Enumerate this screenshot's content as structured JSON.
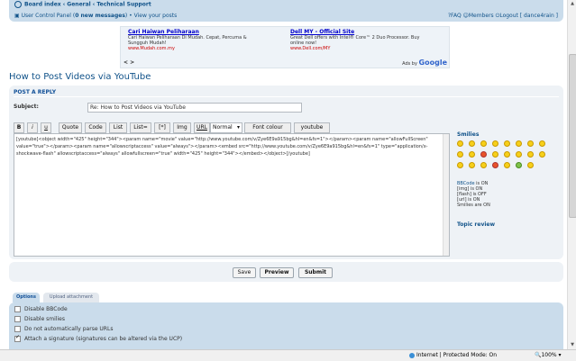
{
  "nav": {
    "breadcrumb": "Board index ‹ General ‹ Technical Support",
    "ucp": "User Control Panel (",
    "new_messages": "0 new messages",
    "ucp_close": ")",
    "sep": "•",
    "view_posts": "View your posts",
    "faq": "FAQ",
    "members": "Members",
    "logout": "Logout [ dance4rain ]"
  },
  "ads": {
    "ad1": {
      "title": "Cari Haiwan Peliharaan",
      "desc": "Cari Haiwan Peliharaan Di Mudah. Cepat, Percuma & Sungguh Mudah!",
      "url": "www.Mudah.com.my"
    },
    "ad2": {
      "title": "Dell MY - Official Site",
      "desc": "Great Dell offers with Intel® Core™ 2 Duo Processor. Buy online now!",
      "url": "www.Dell.com/MY"
    },
    "arrows": "< >",
    "adsby": "Ads by",
    "google": "Google"
  },
  "page_title": "How to Post Videos via YouTube",
  "post": {
    "section_title": "POST A REPLY",
    "subject_label": "Subject:",
    "subject_value": "Re: How to Post Videos via YouTube",
    "toolbar": [
      "B",
      "i",
      "u",
      "Quote",
      "Code",
      "List",
      "List=",
      "[*]",
      "Img",
      "URL"
    ],
    "font_size": "Normal",
    "font_colour": "Font colour",
    "youtube": "youtube",
    "message": "[youtube]<object width=\"425\" height=\"344\"><param name=\"movie\" value=\"http://www.youtube.com/v/Zye6E9a915bg&hl=en&fs=1\"></param><param name=\"allowFullScreen\" value=\"true\"></param><param name=\"allowscriptaccess\" value=\"always\"></param><embed src=\"http://www.youtube.com/v/Zye6E9a915bg&hl=en&fs=1\" type=\"application/x-shockwave-flash\" allowscriptaccess=\"always\" allowfullscreen=\"true\" width=\"425\" height=\"344\"></embed></object>[/youtube]"
  },
  "sidebar": {
    "smilies_heading": "Smilies",
    "bbcode_link": "BBCode",
    "bbcode_status": " is ON",
    "img_status": "[img] is ON",
    "flash_status": "[flash] is OFF",
    "url_status": "[url] is ON",
    "smilies_status": "Smilies are ON",
    "topic_review": "Topic review"
  },
  "buttons": {
    "save": "Save",
    "preview": "Preview",
    "submit": "Submit"
  },
  "tabs": {
    "options": "Options",
    "upload": "Upload attachment"
  },
  "options": [
    {
      "label": "Disable BBCode",
      "checked": false
    },
    {
      "label": "Disable smilies",
      "checked": false
    },
    {
      "label": "Do not automatically parse URLs",
      "checked": false
    },
    {
      "label": "Attach a signature (signatures can be altered via the UCP)",
      "checked": true
    }
  ],
  "status": {
    "zone": "Internet | Protected Mode: On",
    "zoom": "100%"
  }
}
